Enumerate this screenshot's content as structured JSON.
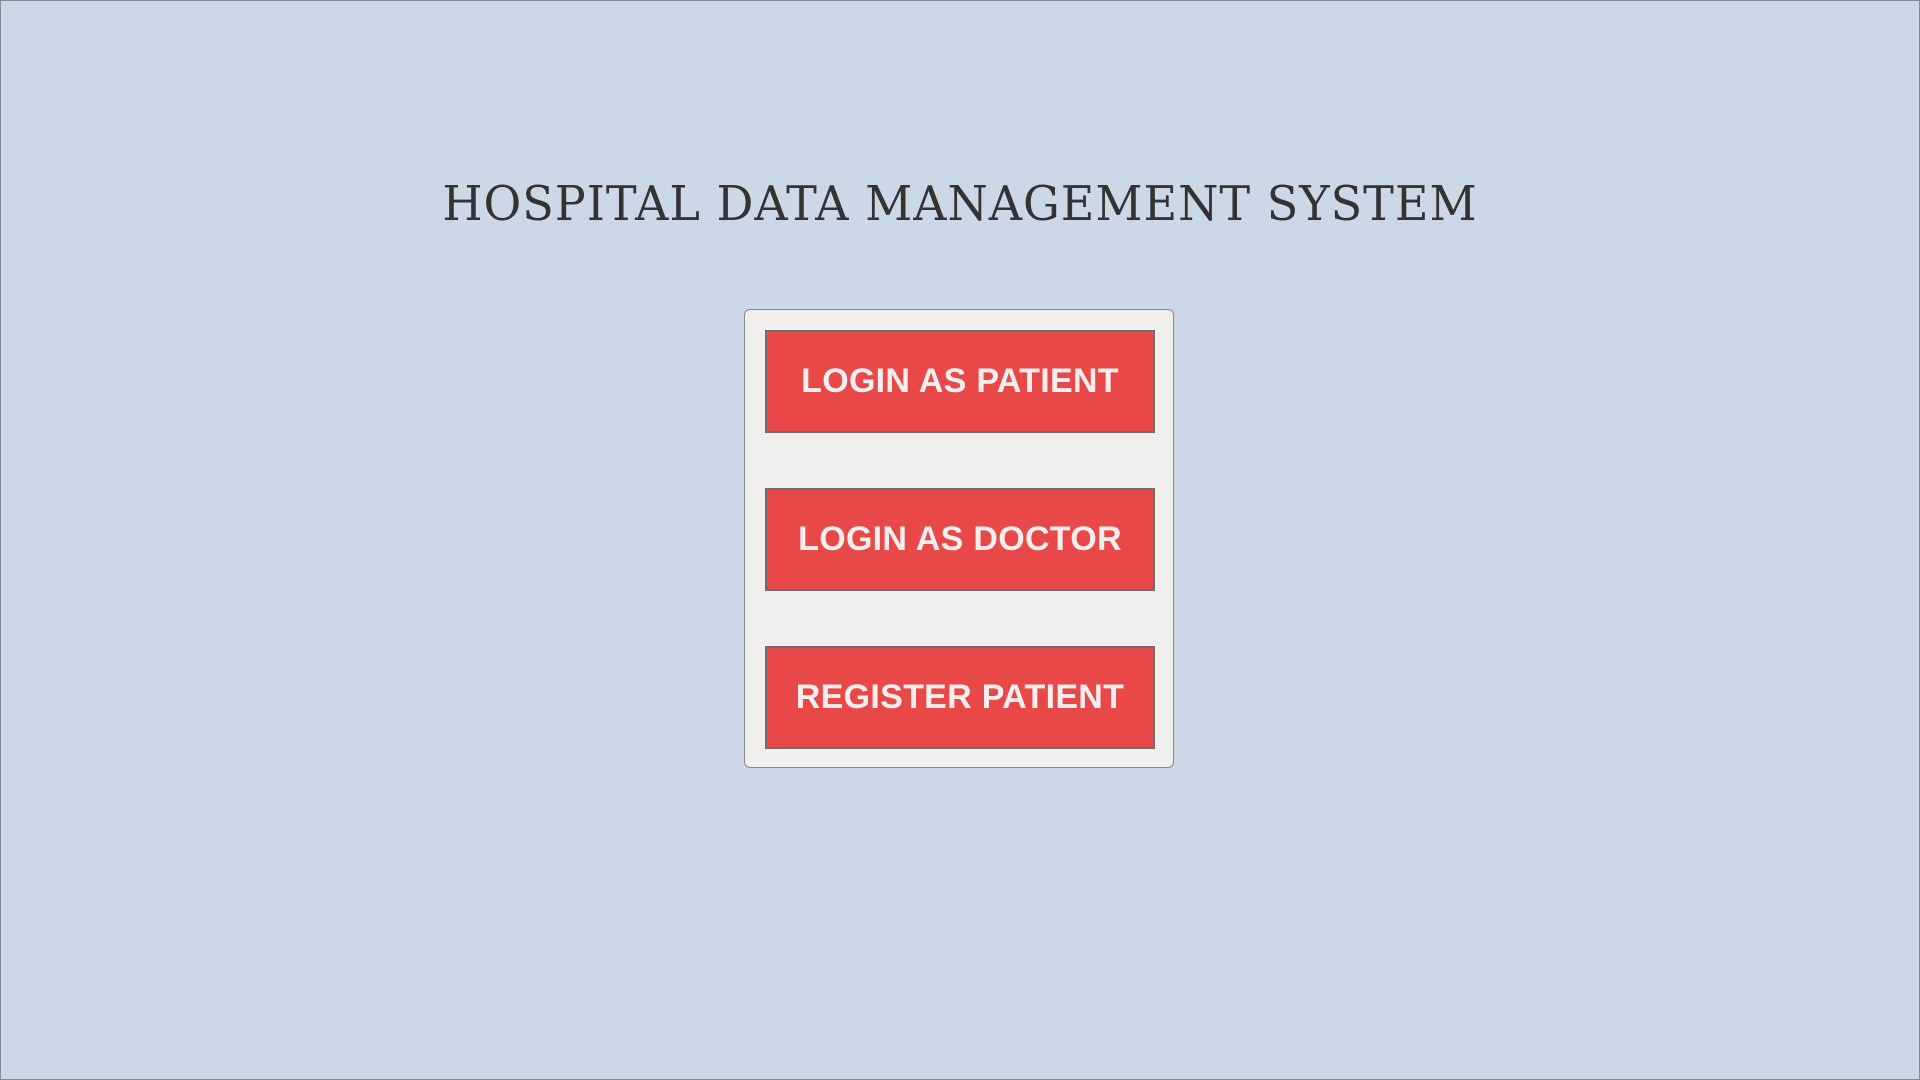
{
  "app": {
    "title": "HOSPITAL DATA MANAGEMENT SYSTEM"
  },
  "menu": {
    "login_patient_label": "LOGIN AS PATIENT",
    "login_doctor_label": "LOGIN AS DOCTOR",
    "register_patient_label": "REGISTER PATIENT"
  },
  "colors": {
    "background": "#cbd9e6",
    "panel": "#f1efee",
    "button": "#e84848",
    "button_text": "#f4efef",
    "title_text": "#333333"
  }
}
